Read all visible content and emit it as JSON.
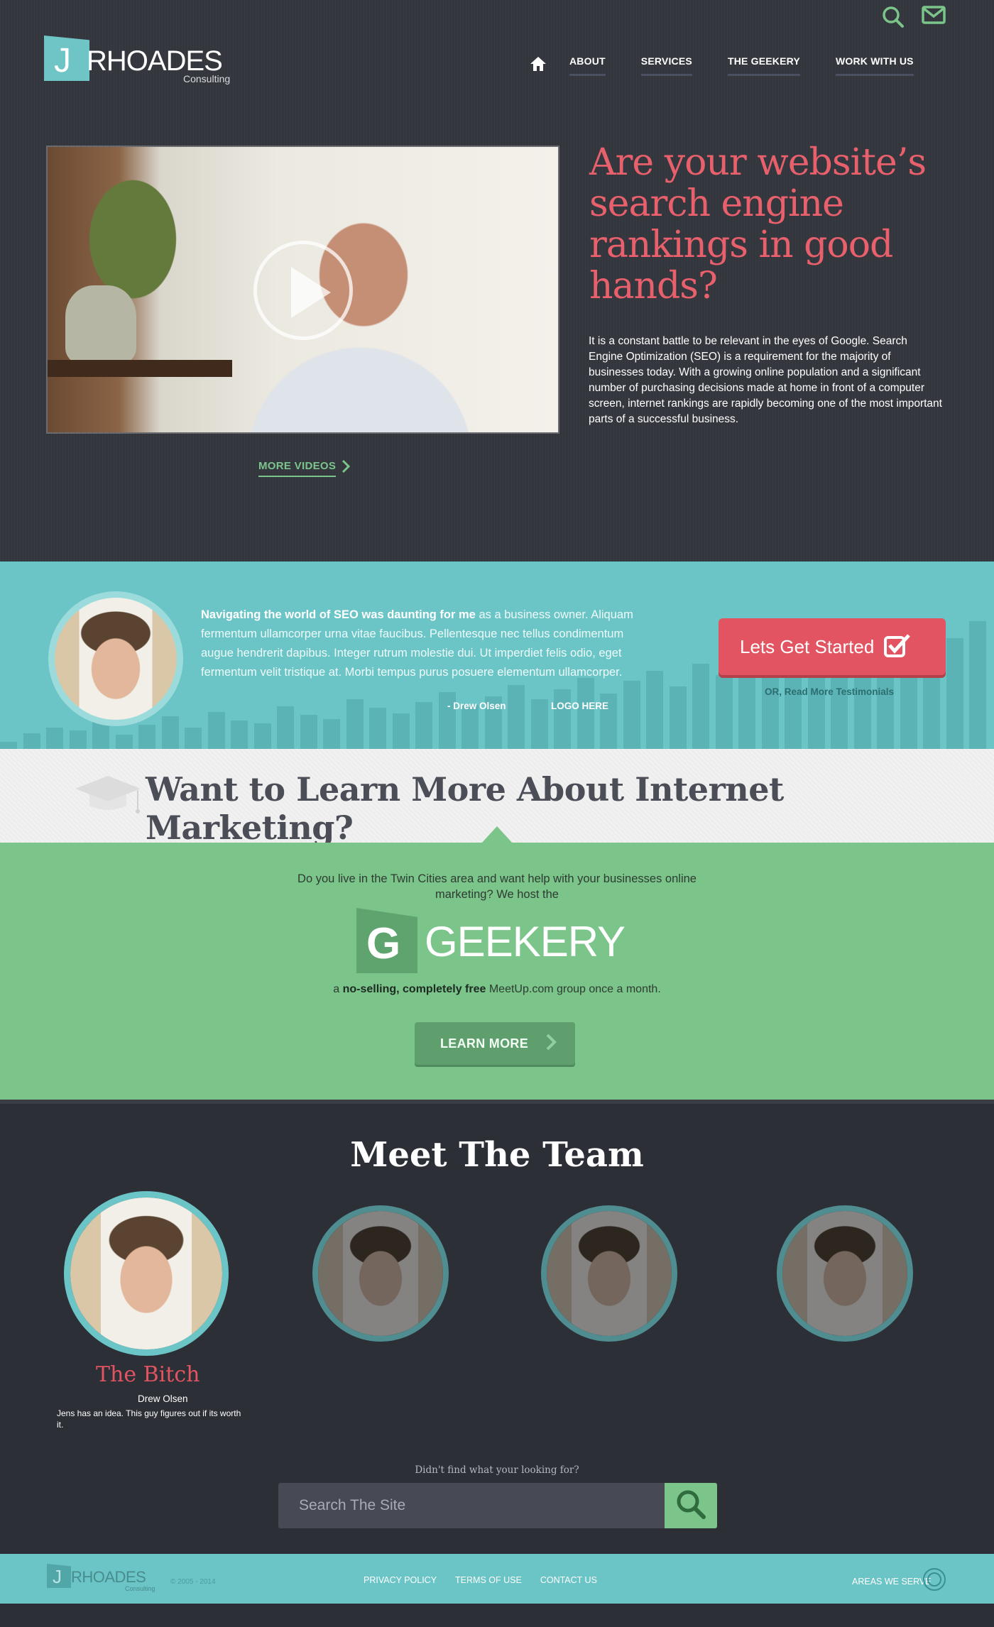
{
  "brand": {
    "logo_letter": "J",
    "logo_word": "RHOADES",
    "logo_sub": "Consulting"
  },
  "header_icons": [
    "search-icon",
    "mail-icon"
  ],
  "nav": {
    "home_icon": "home-icon",
    "items": [
      "ABOUT",
      "SERVICES",
      "THE GEEKERY",
      "WORK WITH US"
    ]
  },
  "hero": {
    "headline": "Are your website’s search engine rankings in good hands?",
    "intro": "It is a constant battle to be relevant in the eyes of Google. Search Engine Optimization (SEO) is a requirement for the majority of businesses today. With a growing online population and a significant number of purchasing decisions made at home in front of a computer screen, internet rankings are rapidly becoming one of the most important parts of a successful business.",
    "more_videos": "MORE VIDEOS"
  },
  "testimonial": {
    "quote_bold": "Navigating the world of SEO was daunting for me",
    "quote_rest": " as a business owner. Aliquam fermentum ullamcorper urna vitae faucibus. Pellentesque nec tellus condimentum augue hendrerit dapibus. Integer rutrum molestie dui. Ut imperdiet felis odio, eget fermentum velit tristique at. Morbi tempus purus posuere elementum ullamcorper.",
    "author": "- Drew Olsen",
    "logo": "LOGO HERE",
    "cta_label": "Lets Get Started",
    "cta_sub_prefix": "OR,",
    "cta_sub_link": "Read More Testimonials"
  },
  "learn": {
    "title": "Want to Learn More About Internet Marketing?"
  },
  "geekery": {
    "text": "Do you live in the Twin Cities area and want help with your businesses online marketing? We host the",
    "logo_letter": "G",
    "logo_word": "GEEKERY",
    "sub_prefix": "a ",
    "sub_bold": "no-selling, completely free",
    "sub_rest": " MeetUp.com group once a month.",
    "button": "LEARN MORE"
  },
  "team": {
    "title": "Meet The Team",
    "featured": {
      "role": "The Bitch",
      "name": "Drew Olsen",
      "bio": "Jens has an idea. This guy figures out if its worth it."
    },
    "search_prompt": "Didn't find what your looking for?",
    "search_placeholder": "Search The Site"
  },
  "footer": {
    "logo_letter": "J",
    "logo_word": "RHOADES",
    "logo_sub": "Consulting",
    "copyright": "© 2005 - 2014",
    "links": [
      "PRIVACY POLICY",
      "TERMS OF USE",
      "CONTACT US"
    ],
    "areas": "AREAS WE SERVE"
  },
  "colors": {
    "accent_red": "#e25461",
    "accent_teal": "#6bc4c5",
    "accent_green": "#7bc48a",
    "dark_bg": "#2d2f37"
  }
}
